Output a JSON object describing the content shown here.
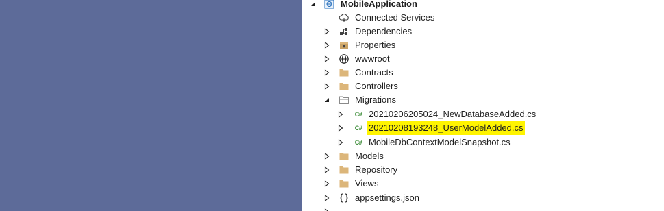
{
  "tree": {
    "project": {
      "label": "MobileApplication",
      "icon": "web-project-icon"
    },
    "items": [
      {
        "label": "Connected Services",
        "icon": "connected-services-icon"
      },
      {
        "label": "Dependencies",
        "icon": "dependencies-icon"
      },
      {
        "label": "Properties",
        "icon": "properties-icon"
      },
      {
        "label": "wwwroot",
        "icon": "globe-icon"
      },
      {
        "label": "Contracts",
        "icon": "folder-icon"
      },
      {
        "label": "Controllers",
        "icon": "folder-icon"
      },
      {
        "label": "Migrations",
        "icon": "folder-open-icon"
      },
      {
        "label": "20210206205024_NewDatabaseAdded.cs",
        "icon": "csharp-file-icon",
        "icon_text": "C#"
      },
      {
        "label": "20210208193248_UserModelAdded.cs",
        "icon": "csharp-file-icon",
        "icon_text": "C#",
        "highlighted": true
      },
      {
        "label": "MobileDbContextModelSnapshot.cs",
        "icon": "csharp-file-icon",
        "icon_text": "C#"
      },
      {
        "label": "Models",
        "icon": "folder-icon"
      },
      {
        "label": "Repository",
        "icon": "folder-icon"
      },
      {
        "label": "Views",
        "icon": "folder-icon"
      },
      {
        "label": "appsettings.json",
        "icon": "json-file-icon"
      }
    ]
  },
  "colors": {
    "left_pane": "#5d6b99",
    "highlight": "#fff400",
    "folder": "#dcb67a",
    "csharp": "#388a34"
  }
}
